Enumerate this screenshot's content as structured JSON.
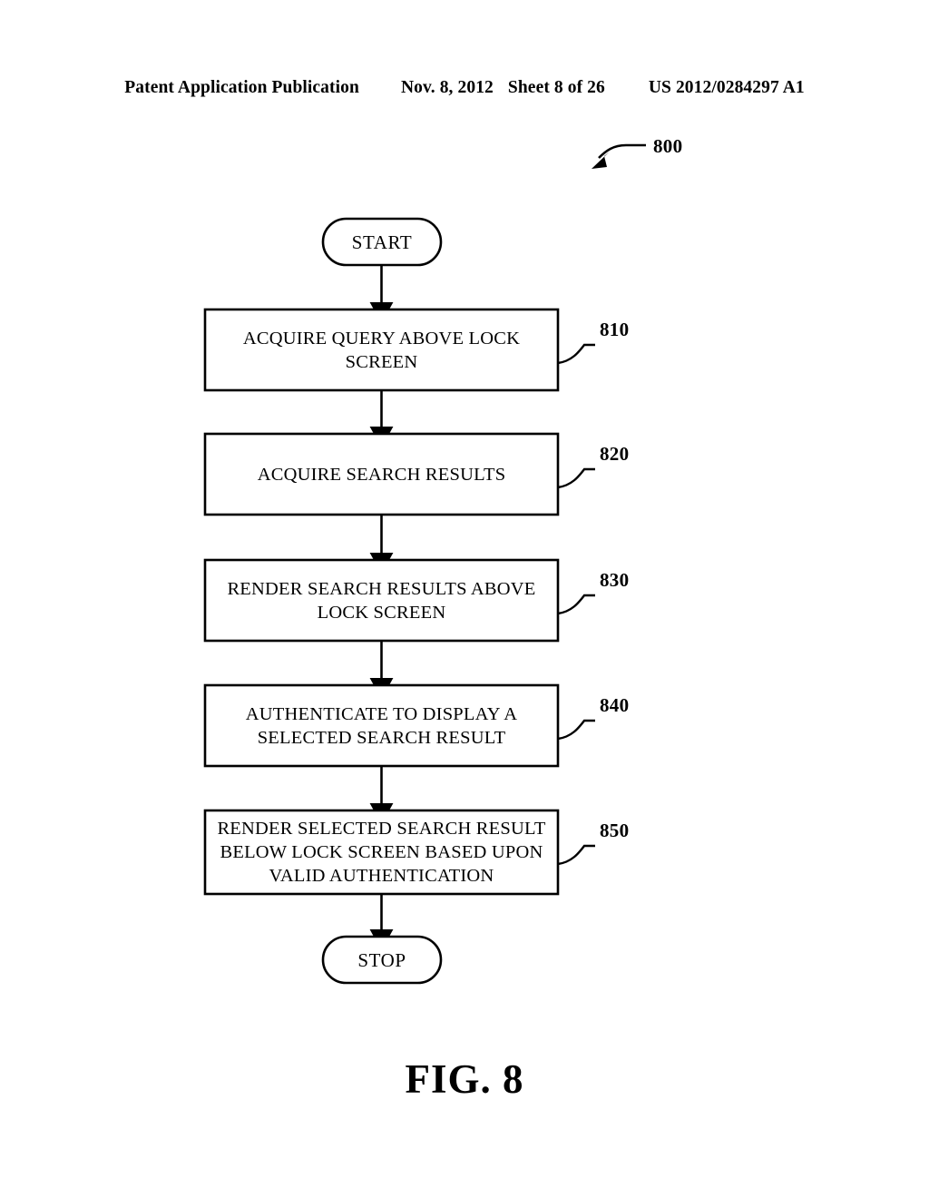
{
  "header": {
    "publication": "Patent Application Publication",
    "date": "Nov. 8, 2012",
    "sheet": "Sheet 8 of 26",
    "patent_number": "US 2012/0284297 A1"
  },
  "figure": {
    "caption": "FIG. 8",
    "diagram_ref": "800"
  },
  "flowchart": {
    "type": "flowchart",
    "start": {
      "label": "START",
      "shape": "stadium"
    },
    "stop": {
      "label": "STOP",
      "shape": "stadium"
    },
    "steps": [
      {
        "ref": "810",
        "shape": "rectangle",
        "lines": [
          "ACQUIRE QUERY ABOVE LOCK",
          "SCREEN"
        ]
      },
      {
        "ref": "820",
        "shape": "rectangle",
        "lines": [
          "ACQUIRE SEARCH RESULTS"
        ]
      },
      {
        "ref": "830",
        "shape": "rectangle",
        "lines": [
          "RENDER SEARCH RESULTS ABOVE",
          "LOCK SCREEN"
        ]
      },
      {
        "ref": "840",
        "shape": "rectangle",
        "lines": [
          "AUTHENTICATE TO DISPLAY A",
          "SELECTED SEARCH RESULT"
        ]
      },
      {
        "ref": "850",
        "shape": "rectangle",
        "lines": [
          "RENDER SELECTED SEARCH RESULT",
          "BELOW LOCK SCREEN BASED UPON",
          "VALID AUTHENTICATION"
        ]
      }
    ]
  },
  "colors": {
    "ink": "#000000",
    "paper": "#ffffff"
  }
}
